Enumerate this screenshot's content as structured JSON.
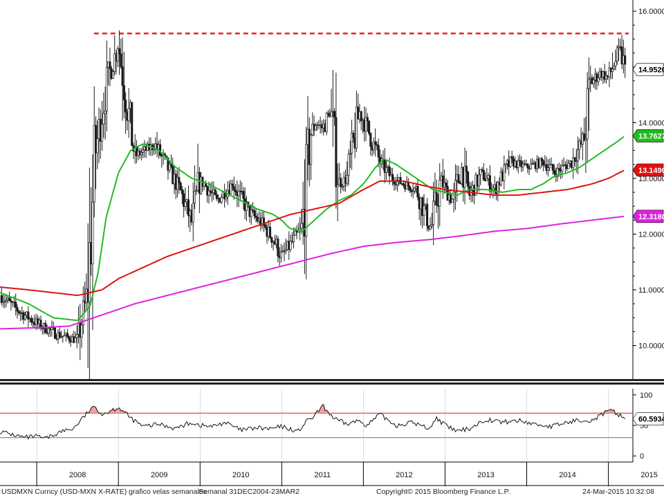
{
  "chart_data": [
    {
      "type": "candlestick",
      "ticker": "USDMXN Curncy (USD-MXN X-RATE) grafico velas semanales",
      "period": "Semanal 31DEC2004-23MAR2",
      "x_labels": [
        "2008",
        "2009",
        "2010",
        "2011",
        "2012",
        "2013",
        "2014",
        "2015"
      ],
      "x_range": [
        2007.55,
        2015.3
      ],
      "ylim": [
        9.4,
        16.2
      ],
      "y_ticks": [
        10.0,
        11.0,
        12.0,
        13.0,
        14.0,
        15.0,
        16.0
      ],
      "y_tick_labels": [
        "10.0000",
        "11.0000",
        "12.0000",
        "13.0000",
        "14.0000",
        "15.0000",
        "16.0000"
      ],
      "resistance": {
        "value": 15.6,
        "x_from": 2008.7,
        "x_to": 2015.25,
        "color": "#e02020"
      },
      "candle_color": "#1a1a1a",
      "price_anchors": {
        "x": [
          2007.55,
          2007.8,
          2008.0,
          2008.25,
          2008.5,
          2008.62,
          2008.72,
          2008.8,
          2008.87,
          2009.0,
          2009.2,
          2009.45,
          2009.6,
          2009.75,
          2009.9,
          2010.0,
          2010.2,
          2010.4,
          2010.6,
          2010.75,
          2010.9,
          2011.0,
          2011.1,
          2011.25,
          2011.35,
          2011.42,
          2011.5,
          2011.6,
          2011.7,
          2011.8,
          2011.95,
          2012.05,
          2012.2,
          2012.35,
          2012.5,
          2012.65,
          2012.75,
          2012.83,
          2012.95,
          2013.0,
          2013.1,
          2013.2,
          2013.3,
          2013.45,
          2013.6,
          2013.8,
          2014.0,
          2014.2,
          2014.35,
          2014.55,
          2014.7,
          2014.78,
          2014.9,
          2015.0,
          2015.08,
          2015.15,
          2015.2
        ],
        "y": [
          10.9,
          10.6,
          10.4,
          10.2,
          10.1,
          10.9,
          13.5,
          14.2,
          14.8,
          15.4,
          13.4,
          13.6,
          13.2,
          12.8,
          12.2,
          13.0,
          12.6,
          12.9,
          12.4,
          12.2,
          11.9,
          11.6,
          11.8,
          12.1,
          13.8,
          14.0,
          13.9,
          14.2,
          12.9,
          13.0,
          14.2,
          13.9,
          13.3,
          13.0,
          12.9,
          12.8,
          12.4,
          12.1,
          13.0,
          12.8,
          12.6,
          13.2,
          12.7,
          13.1,
          12.8,
          13.3,
          13.2,
          13.3,
          13.1,
          13.3,
          13.7,
          14.7,
          14.9,
          14.8,
          15.1,
          15.3,
          14.95
        ]
      },
      "series": [
        {
          "name": "",
          "color": "#22bb22",
          "last": 13.7627,
          "label": "13.7627",
          "x": [
            2007.55,
            2007.9,
            2008.2,
            2008.5,
            2008.65,
            2008.75,
            2008.85,
            2009.0,
            2009.15,
            2009.3,
            2009.5,
            2009.7,
            2009.9,
            2010.1,
            2010.3,
            2010.5,
            2010.7,
            2010.9,
            2011.0,
            2011.1,
            2011.25,
            2011.4,
            2011.55,
            2011.7,
            2011.85,
            2012.0,
            2012.15,
            2012.25,
            2012.4,
            2012.55,
            2012.7,
            2012.85,
            2013.0,
            2013.15,
            2013.3,
            2013.5,
            2013.7,
            2013.9,
            2014.05,
            2014.2,
            2014.35,
            2014.5,
            2014.65,
            2014.8,
            2014.95,
            2015.1,
            2015.2
          ],
          "y": [
            10.95,
            10.75,
            10.5,
            10.45,
            10.7,
            11.3,
            12.3,
            13.1,
            13.5,
            13.62,
            13.5,
            13.2,
            13.0,
            12.9,
            12.75,
            12.6,
            12.45,
            12.35,
            12.25,
            12.1,
            12.05,
            12.25,
            12.45,
            12.6,
            12.7,
            12.9,
            13.2,
            13.35,
            13.25,
            13.1,
            12.95,
            12.8,
            12.75,
            12.7,
            12.8,
            12.8,
            12.75,
            12.8,
            12.8,
            12.9,
            13.05,
            13.1,
            13.2,
            13.35,
            13.5,
            13.65,
            13.76
          ]
        },
        {
          "name": "",
          "color": "#dd1111",
          "last": 13.149,
          "label": "13.1490",
          "x": [
            2007.55,
            2007.9,
            2008.2,
            2008.5,
            2008.8,
            2009.0,
            2009.3,
            2009.6,
            2009.9,
            2010.2,
            2010.5,
            2010.8,
            2011.1,
            2011.4,
            2011.7,
            2012.0,
            2012.2,
            2012.5,
            2012.8,
            2013.0,
            2013.3,
            2013.6,
            2013.9,
            2014.2,
            2014.5,
            2014.8,
            2015.0,
            2015.2
          ],
          "y": [
            11.05,
            11.0,
            10.95,
            10.9,
            11.0,
            11.2,
            11.4,
            11.6,
            11.75,
            11.9,
            12.05,
            12.2,
            12.35,
            12.45,
            12.55,
            12.8,
            12.95,
            12.95,
            12.85,
            12.8,
            12.75,
            12.7,
            12.7,
            12.75,
            12.8,
            12.9,
            13.0,
            13.15
          ]
        },
        {
          "name": "",
          "color": "#dd22dd",
          "last": 12.318,
          "label": "12.3180",
          "x": [
            2007.55,
            2008.0,
            2008.4,
            2008.8,
            2009.2,
            2009.6,
            2010.0,
            2010.4,
            2010.8,
            2011.2,
            2011.6,
            2012.0,
            2012.4,
            2012.8,
            2013.2,
            2013.6,
            2014.0,
            2014.4,
            2014.8,
            2015.2
          ],
          "y": [
            10.3,
            10.32,
            10.35,
            10.55,
            10.75,
            10.9,
            11.05,
            11.2,
            11.35,
            11.5,
            11.65,
            11.78,
            11.85,
            11.9,
            11.97,
            12.05,
            12.1,
            12.18,
            12.25,
            12.32
          ]
        }
      ],
      "last_price": {
        "value": 14.952,
        "label": "14.9520"
      }
    },
    {
      "type": "line",
      "ylim": [
        -10,
        110
      ],
      "y_ticks": [
        0,
        50,
        100
      ],
      "y_tick_labels": [
        "0",
        "50",
        "100"
      ],
      "overbought": 70,
      "oversold": 30,
      "overbought_color": "#dd3333",
      "oversold_color": "#22bb22",
      "fill_color": "#f2a0a0",
      "line_color": "#111111",
      "last": 60.5934,
      "label": "60.5934",
      "anchors": {
        "x": [
          2007.55,
          2007.7,
          2007.85,
          2008.0,
          2008.1,
          2008.3,
          2008.45,
          2008.55,
          2008.65,
          2008.72,
          2008.8,
          2008.9,
          2009.0,
          2009.15,
          2009.3,
          2009.5,
          2009.7,
          2009.9,
          2010.0,
          2010.15,
          2010.3,
          2010.5,
          2010.7,
          2010.85,
          2011.0,
          2011.2,
          2011.3,
          2011.4,
          2011.5,
          2011.65,
          2011.8,
          2011.95,
          2012.05,
          2012.2,
          2012.4,
          2012.6,
          2012.8,
          2012.9,
          2013.0,
          2013.15,
          2013.3,
          2013.5,
          2013.7,
          2013.9,
          2014.1,
          2014.3,
          2014.5,
          2014.7,
          2014.8,
          2014.95,
          2015.05,
          2015.15,
          2015.22
        ],
        "y": [
          40,
          35,
          30,
          32,
          28,
          40,
          45,
          60,
          75,
          80,
          68,
          74,
          80,
          62,
          48,
          52,
          45,
          55,
          50,
          48,
          55,
          42,
          46,
          44,
          48,
          40,
          56,
          65,
          82,
          60,
          52,
          58,
          50,
          68,
          50,
          55,
          45,
          62,
          50,
          40,
          45,
          60,
          55,
          58,
          52,
          48,
          55,
          60,
          58,
          70,
          74,
          66,
          60.6
        ]
      }
    }
  ],
  "footer": {
    "ticker": "USDMXN Curncy (USD-MXN X-RATE) grafico velas semanales",
    "period": "Semanal 31DEC2004-23MAR2",
    "copyright": "Copyright© 2015 Bloomberg Finance L.P.",
    "timestamp": "24-Mar-2015 10:32:08"
  }
}
